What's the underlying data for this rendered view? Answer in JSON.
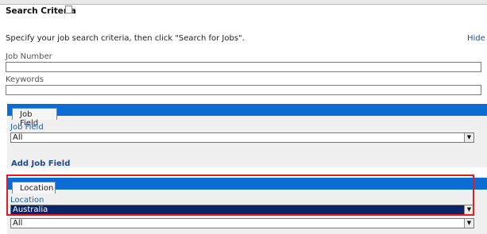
{
  "section_title": "Search Criteria",
  "intro_text": "Specify your job search criteria, then click \"Search for Jobs\".",
  "hide_link": "Hide S",
  "job_number": {
    "label": "Job Number",
    "value": ""
  },
  "keywords": {
    "label": "Keywords",
    "value": ""
  },
  "job_field_section": {
    "tab_label": "Job Field",
    "field_label": "Job Field",
    "selected_value": "All",
    "add_link": "Add Job Field"
  },
  "location_section": {
    "tab_label": "Location",
    "field_label": "Location",
    "selected_value": "Australia",
    "second_select_value": "All"
  },
  "colors": {
    "header_blue": "#0b6cd3",
    "highlight_red": "#e11d1d",
    "selected_bg": "#0a246a"
  },
  "icons": {
    "title_icon": "collapse-box-icon",
    "dropdown_icon": "chevron-down-icon"
  }
}
